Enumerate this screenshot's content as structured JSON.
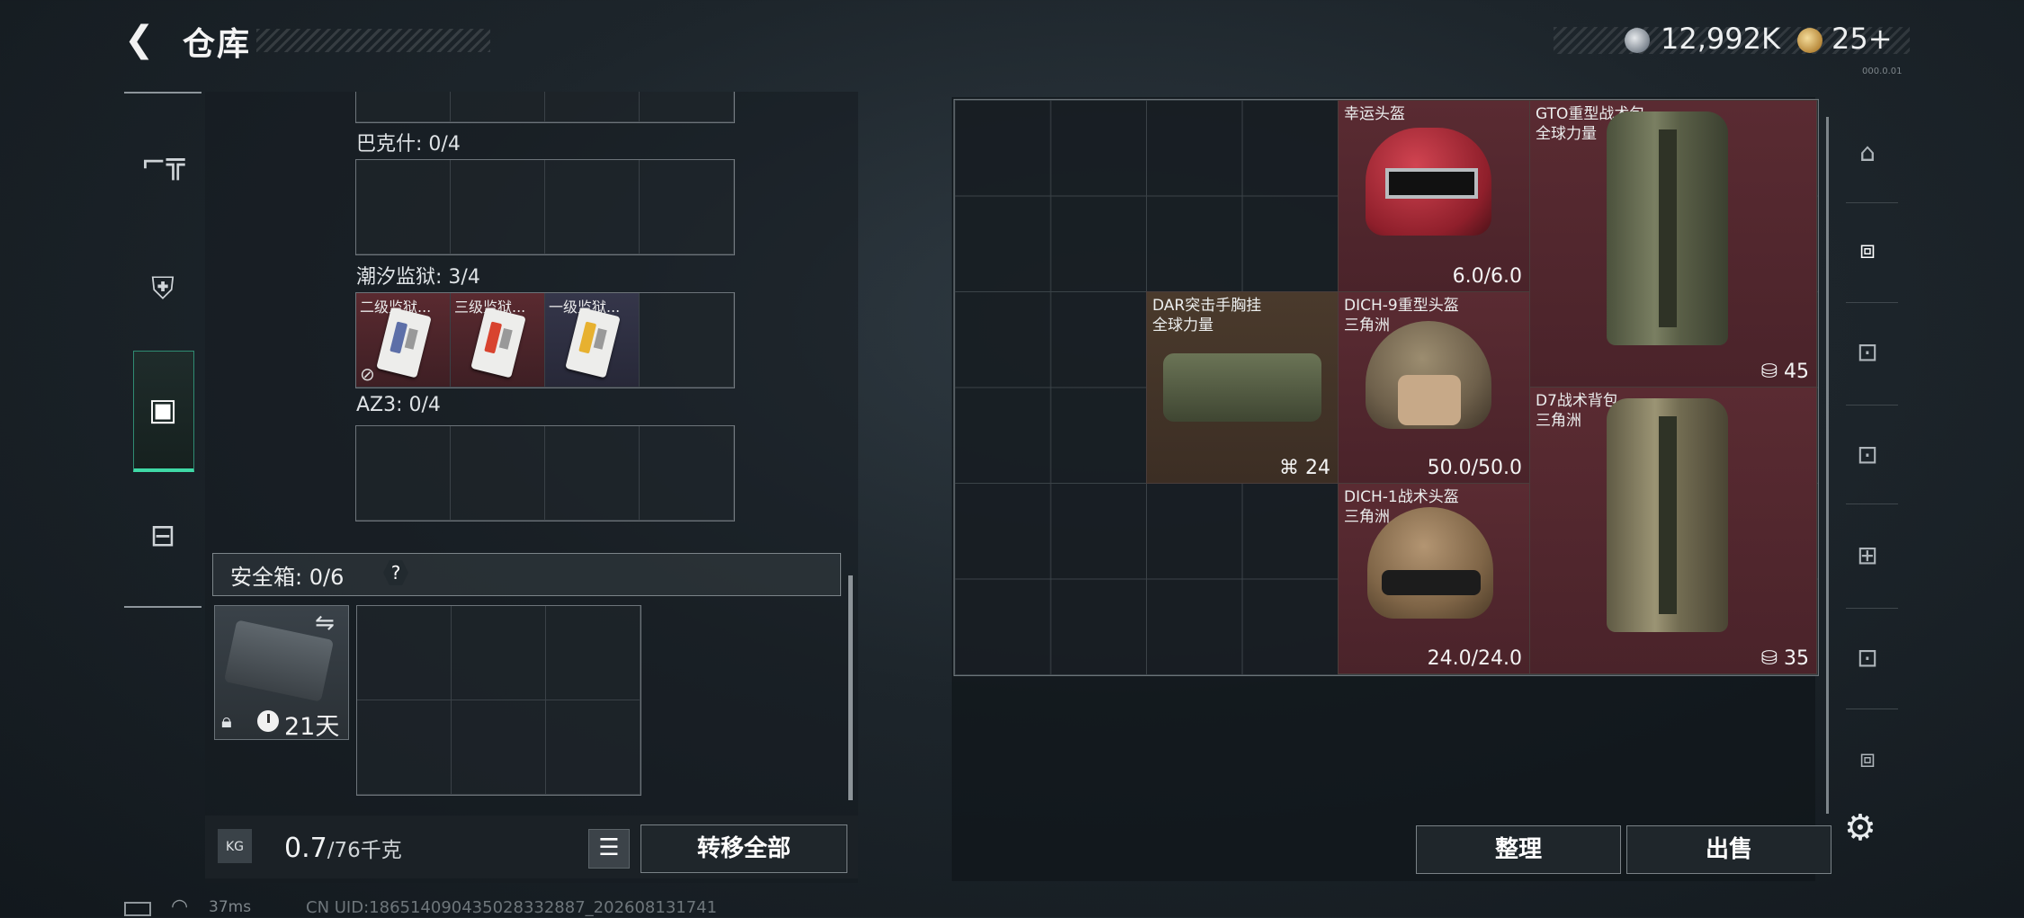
{
  "header": {
    "back_icon": "chevron-left-icon",
    "title": "仓库",
    "money": "12,992K",
    "tickets": "25+",
    "small_code": "000.0.01"
  },
  "left_rail": [
    "pistol-icon",
    "armor-plate-icon",
    "backpack-icon",
    "toolbox-icon"
  ],
  "containers": [
    {
      "label": "巴克什: 0/4",
      "slots": []
    },
    {
      "label": "潮汐监狱: 3/4",
      "slots": [
        {
          "name": "二级监狱...",
          "rarity": "red",
          "stripe": "#5d6fa8"
        },
        {
          "name": "三级监狱...",
          "rarity": "red",
          "stripe": "#d8432f"
        },
        {
          "name": "一级监狱...",
          "rarity": "blue",
          "stripe": "#e7b130"
        }
      ]
    },
    {
      "label": "AZ3: 0/4",
      "slots": []
    }
  ],
  "safe_box": {
    "label": "安全箱: 0/6",
    "help": "?",
    "time_left": "21天"
  },
  "weight": {
    "current": "0.7",
    "max": "/76千克",
    "icon_label": "KG"
  },
  "buttons": {
    "transfer_all": "转移全部",
    "sort": "整理",
    "sell": "出售"
  },
  "stash_items": [
    {
      "name_line1": "幸运头盔",
      "name_line2": "",
      "value": "6.0/6.0"
    },
    {
      "name_line1": "GTO重型战术包",
      "name_line2": "全球力量",
      "value": "45"
    },
    {
      "name_line1": "DAR突击手胸挂",
      "name_line2": "全球力量",
      "value": "24"
    },
    {
      "name_line1": "DICH-9重型头盔",
      "name_line2": "三角洲",
      "value": "50.0/50.0"
    },
    {
      "name_line1": "D7战术背包",
      "name_line2": "三角洲",
      "value": "35"
    },
    {
      "name_line1": "DICH-1战术头盔",
      "name_line2": "三角洲",
      "value": "24.0/24.0"
    }
  ],
  "right_rail": [
    "helmet-icon",
    "armor-icon",
    "lv4-rig-icon",
    "lv4-vest-icon",
    "backpack-slot-icon",
    "lv4-vest-alt-icon",
    "armor-slot-icon"
  ],
  "status": {
    "ping": "37ms",
    "uid": "CN UID:18651409043502833288​7_202608131741"
  }
}
